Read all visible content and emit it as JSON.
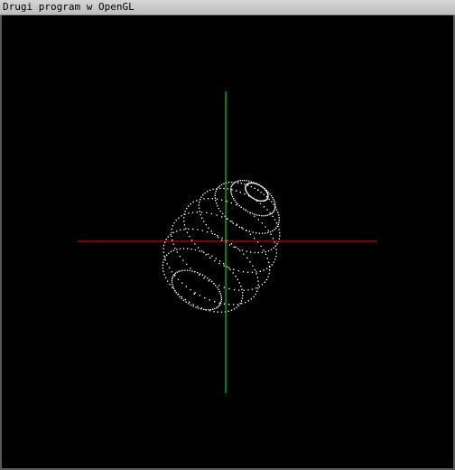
{
  "window": {
    "title": "Drugi program w OpenGL"
  },
  "scene": {
    "background_color": "#000000",
    "x_axis_color": "#ff0000",
    "y_axis_color": "#00ff00",
    "point_color": "#ffffff",
    "object": "egg",
    "render_mode": "points"
  }
}
